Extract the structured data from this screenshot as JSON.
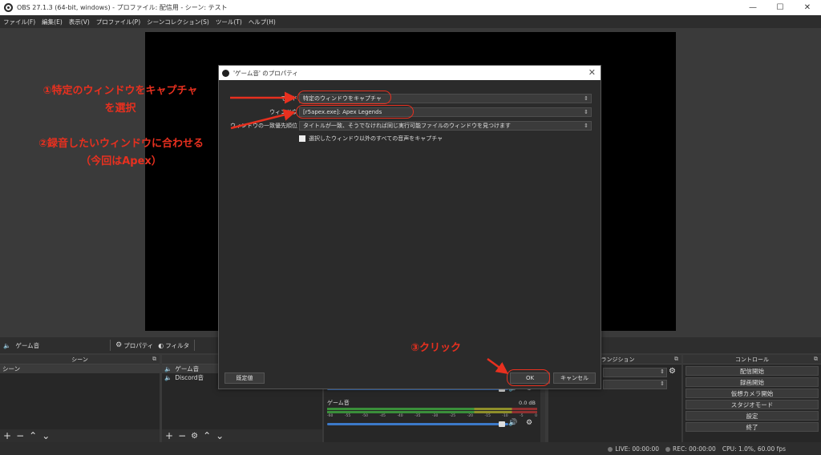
{
  "window": {
    "title": "OBS 27.1.3 (64-bit, windows) - プロファイル: 配信用 - シーン: テスト",
    "minimize": "—",
    "maximize": "☐",
    "close": "✕"
  },
  "menu": {
    "items": [
      "ファイル(F)",
      "編集(E)",
      "表示(V)",
      "プロファイル(P)",
      "シーンコレクション(S)",
      "ツール(T)",
      "ヘルプ(H)"
    ]
  },
  "source_toolbar": {
    "source_name": "ゲーム音",
    "properties_label": "プロパティ",
    "filters_label": "フィルタ"
  },
  "scenes_dock": {
    "header": "シーン",
    "items": [
      "シーン"
    ]
  },
  "sources_dock": {
    "items": [
      "ゲーム音",
      "Discord音"
    ]
  },
  "mixer": {
    "channel_name": "ゲーム音",
    "level_db": "0.0 dB",
    "scale": [
      "-60",
      "-55",
      "-50",
      "-45",
      "-40",
      "-35",
      "-30",
      "-25",
      "-20",
      "-15",
      "-10",
      "-5",
      "0"
    ]
  },
  "transitions_dock": {
    "header": "トランジション"
  },
  "controls_dock": {
    "header": "コントロール",
    "buttons": [
      "配信開始",
      "録画開始",
      "仮想カメラ開始",
      "スタジオモード",
      "設定",
      "終了"
    ]
  },
  "status": {
    "live": "LIVE: 00:00:00",
    "rec": "REC: 00:00:00",
    "cpu": "CPU: 1.0%, 60.00 fps"
  },
  "dialog": {
    "title": "'ゲーム音' のプロパティ",
    "close": "✕",
    "mode_label": "モード",
    "mode_value": "特定のウィンドウをキャプチャ",
    "window_label": "ウィンドウ",
    "window_value": "[r5apex.exe]: Apex Legends",
    "priority_label": "ウィンドウの一致優先順位",
    "priority_value": "タイトルが一致、そうでなければ同じ実行可能ファイルのウィンドウを見つけます",
    "checkbox_label": "選択したウィンドウ以外のすべての音声をキャプチャ",
    "defaults_button": "既定値",
    "ok_button": "OK",
    "cancel_button": "キャンセル"
  },
  "annotations": {
    "step1_line1": "①特定のウィンドウをキャプチャ",
    "step1_line2": "を選択",
    "step2_line1": "②録音したいウィンドウに合わせる",
    "step2_line2": "（今回はApex）",
    "step3": "③クリック",
    "color": "#e8301f"
  }
}
